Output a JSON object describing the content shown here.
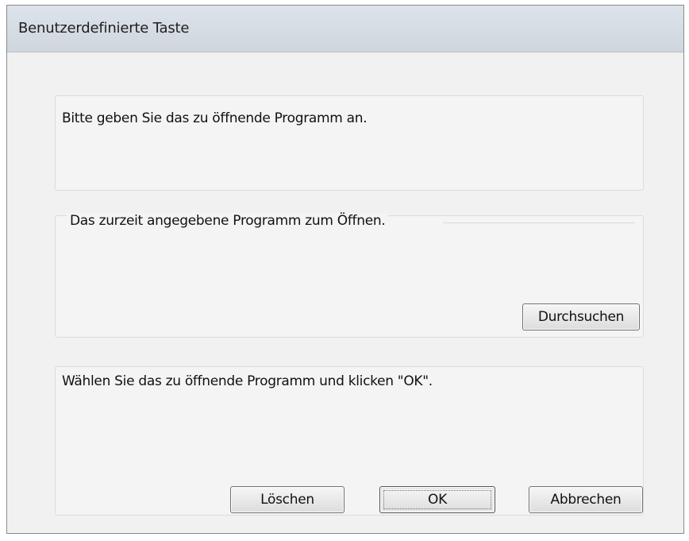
{
  "window": {
    "title": "Benutzerdefinierte Taste"
  },
  "panels": {
    "instruction_text": "Bitte geben Sie das zu öffnende Programm an.",
    "current_program_group_label": "Das zurzeit angegebene Programm zum Öffnen.",
    "select_hint_text": "Wählen Sie das zu öffnende Programm und klicken \"OK\"."
  },
  "buttons": {
    "browse_label": "Durchsuchen",
    "clear_label": "Löschen",
    "ok_label": "OK",
    "cancel_label": "Abbrechen"
  }
}
